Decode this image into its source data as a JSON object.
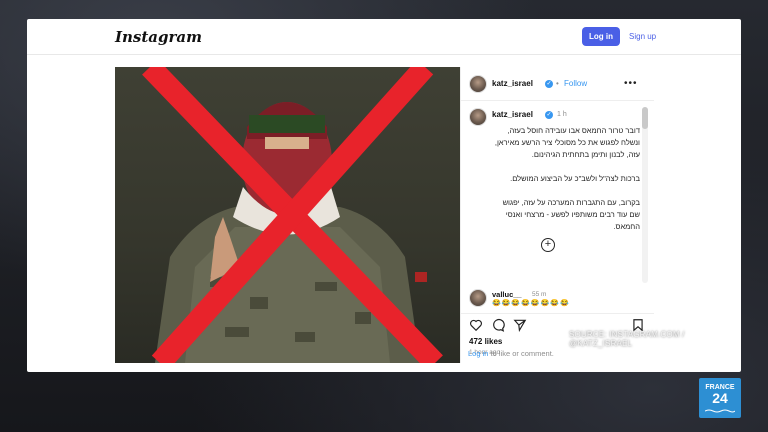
{
  "header": {
    "logo": "Instagram",
    "login_label": "Log in",
    "signup_label": "Sign up"
  },
  "post": {
    "author": "katz_israel",
    "follow_label": "Follow",
    "dot": "•",
    "more": "•••",
    "caption_time": "1 h",
    "caption_paragraphs": [
      "דובר טרור החמאס אבו עובידה חוסל בעזה, ונשלח לפגוש את כל מסוכלי ציר הרשע מאיראן, עזה, לבנון ותימן בתחתית הגיהינום.",
      "ברכות לצה\"ל ולשב\"כ על הביצוע המושלם.",
      "בקרוב, עם התגברות המערכה על עזה, יפגוש שם עוד רבים משותפיו לפשע - מרצחי ואנסי החמאס."
    ],
    "load_more": "+",
    "comment": {
      "user": "valluc__",
      "time": "55 m",
      "text": "😂😂😂😂😂😂😂😂"
    },
    "likes": "472 likes",
    "posted_ago": "1 hour ago",
    "login_link": "Log in",
    "login_suffix": "to like or comment."
  },
  "overlay": {
    "source": "SOURCE: INSTAGRAM.COM / @KATZ_ISRAEL",
    "channel_line1": "FRANCE",
    "channel_line2": "24"
  },
  "colors": {
    "accent": "#4a5fe6",
    "link": "#3897f0",
    "cross": "#e8232b",
    "channel": "#2d8fd3"
  },
  "icons": [
    "verified-badge-icon",
    "heart-icon",
    "comment-icon",
    "share-icon",
    "bookmark-icon",
    "add-circle-icon",
    "more-options-icon"
  ]
}
